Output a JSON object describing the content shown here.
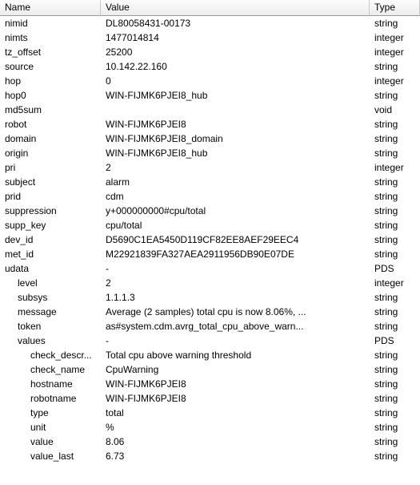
{
  "columns": {
    "name": "Name",
    "value": "Value",
    "type": "Type"
  },
  "rows": [
    {
      "name": "nimid",
      "value": "DL80058431-00173",
      "type": "string",
      "indent": 0
    },
    {
      "name": "nimts",
      "value": "1477014814",
      "type": "integer",
      "indent": 0
    },
    {
      "name": "tz_offset",
      "value": "25200",
      "type": "integer",
      "indent": 0
    },
    {
      "name": "source",
      "value": "10.142.22.160",
      "type": "string",
      "indent": 0
    },
    {
      "name": "hop",
      "value": "0",
      "type": "integer",
      "indent": 0
    },
    {
      "name": "hop0",
      "value": "WIN-FIJMK6PJEI8_hub",
      "type": "string",
      "indent": 0
    },
    {
      "name": "md5sum",
      "value": "",
      "type": "void",
      "indent": 0
    },
    {
      "name": "robot",
      "value": "WIN-FIJMK6PJEI8",
      "type": "string",
      "indent": 0
    },
    {
      "name": "domain",
      "value": "WIN-FIJMK6PJEI8_domain",
      "type": "string",
      "indent": 0
    },
    {
      "name": "origin",
      "value": "WIN-FIJMK6PJEI8_hub",
      "type": "string",
      "indent": 0
    },
    {
      "name": "pri",
      "value": "2",
      "type": "integer",
      "indent": 0
    },
    {
      "name": "subject",
      "value": "alarm",
      "type": "string",
      "indent": 0
    },
    {
      "name": "prid",
      "value": "cdm",
      "type": "string",
      "indent": 0
    },
    {
      "name": "suppression",
      "value": "y+000000000#cpu/total",
      "type": "string",
      "indent": 0
    },
    {
      "name": "supp_key",
      "value": "cpu/total",
      "type": "string",
      "indent": 0
    },
    {
      "name": "dev_id",
      "value": "D5690C1EA5450D119CF82EE8AEF29EEC4",
      "type": "string",
      "indent": 0
    },
    {
      "name": "met_id",
      "value": "M22921839FA327AEA2911956DB90E07DE",
      "type": "string",
      "indent": 0
    },
    {
      "name": "udata",
      "value": "-",
      "type": "PDS",
      "indent": 0
    },
    {
      "name": "level",
      "value": "2",
      "type": "integer",
      "indent": 1
    },
    {
      "name": "subsys",
      "value": "1.1.1.3",
      "type": "string",
      "indent": 1
    },
    {
      "name": "message",
      "value": "Average (2 samples) total cpu is now 8.06%, ...",
      "type": "string",
      "indent": 1
    },
    {
      "name": "token",
      "value": "as#system.cdm.avrg_total_cpu_above_warn...",
      "type": "string",
      "indent": 1
    },
    {
      "name": "values",
      "value": "-",
      "type": "PDS",
      "indent": 1
    },
    {
      "name": "check_descr...",
      "value": "Total cpu above warning threshold",
      "type": "string",
      "indent": 2
    },
    {
      "name": "check_name",
      "value": "CpuWarning",
      "type": "string",
      "indent": 2
    },
    {
      "name": "hostname",
      "value": "WIN-FIJMK6PJEI8",
      "type": "string",
      "indent": 2
    },
    {
      "name": "robotname",
      "value": "WIN-FIJMK6PJEI8",
      "type": "string",
      "indent": 2
    },
    {
      "name": "type",
      "value": "total",
      "type": "string",
      "indent": 2
    },
    {
      "name": "unit",
      "value": "%",
      "type": "string",
      "indent": 2
    },
    {
      "name": "value",
      "value": "8.06",
      "type": "string",
      "indent": 2
    },
    {
      "name": "value_last",
      "value": "6.73",
      "type": "string",
      "indent": 2
    }
  ]
}
